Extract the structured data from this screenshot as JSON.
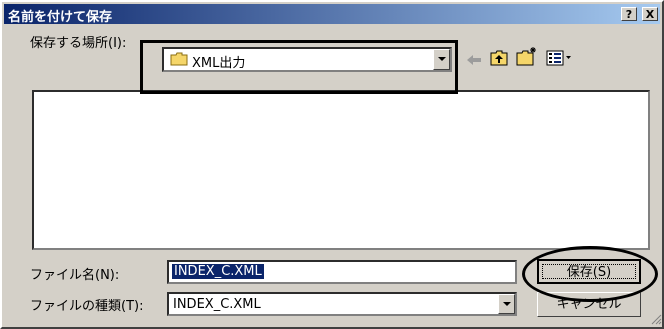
{
  "window": {
    "title": "名前を付けて保存",
    "help_label": "?",
    "close_label": "X"
  },
  "location": {
    "label": "保存する場所(I):",
    "value": "XML出力"
  },
  "filename": {
    "label": "ファイル名(N):",
    "value": "INDEX_C.XML"
  },
  "filetype": {
    "label": "ファイルの種類(T):",
    "value": "INDEX_C.XML"
  },
  "buttons": {
    "save": "保存(S)",
    "cancel": "キャンセル"
  },
  "colors": {
    "title_start": "#0a246a",
    "title_end": "#a6caf0",
    "face": "#d4d0c8",
    "selection": "#0a246a"
  }
}
